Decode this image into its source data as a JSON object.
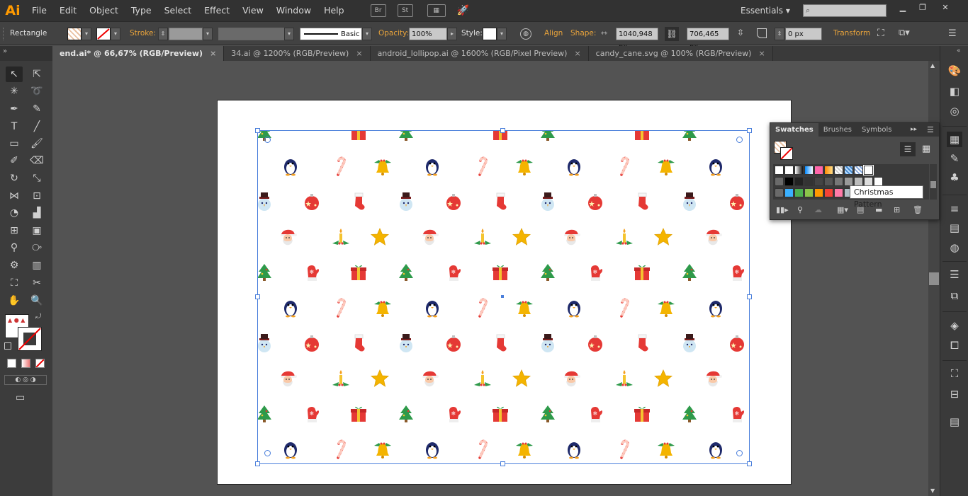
{
  "app": {
    "logo": "Ai",
    "essentials": "Essentials ▾"
  },
  "menu": [
    "File",
    "Edit",
    "Object",
    "Type",
    "Select",
    "Effect",
    "View",
    "Window",
    "Help"
  ],
  "menubar_icons": {
    "bridge": "Br",
    "stock": "St"
  },
  "control": {
    "tool_name": "Rectangle",
    "stroke_label": "Stroke:",
    "brush_label": "Basic",
    "opacity_label": "Opacity:",
    "opacity_value": "100%",
    "style_label": "Style:",
    "align_label": "Align",
    "shape_label": "Shape:",
    "width_value": "1040,948 px",
    "height_value": "706,465 px",
    "corner_value": "0 px",
    "transform_label": "Transform"
  },
  "tabs": [
    {
      "label": "end.ai* @ 66,67% (RGB/Preview)"
    },
    {
      "label": "34.ai @ 1200% (RGB/Preview)"
    },
    {
      "label": "android_lollipop.ai @ 1600% (RGB/Pixel Preview)"
    },
    {
      "label": "candy_cane.svg @ 100% (RGB/Preview)"
    }
  ],
  "tab_close": "×",
  "swatches_panel": {
    "tabs": [
      "Swatches",
      "Brushes",
      "Symbols"
    ],
    "tooltip": "Christmas Pattern"
  },
  "colors": {
    "accent": "#4a7fdb",
    "orange_label": "#e8a33b",
    "ai_logo": "#ff9a00"
  },
  "pattern_rows": [
    [
      "tree",
      "gift",
      "tree",
      "gift",
      "tree",
      "gift",
      "tree"
    ],
    [
      "penguin",
      "cane",
      "bell",
      "penguin",
      "cane",
      "bell",
      "penguin",
      "cane",
      "bell",
      "penguin"
    ],
    [
      "snowman",
      "ornament",
      "stocking",
      "snowman",
      "ornament",
      "stocking",
      "snowman",
      "ornament",
      "stocking",
      "snowman",
      "ornament"
    ],
    [
      "santa",
      "candle",
      "star",
      "santa",
      "candle",
      "star",
      "santa",
      "candle",
      "star",
      "santa"
    ],
    [
      "tree",
      "mitten",
      "gift",
      "tree",
      "mitten",
      "gift",
      "tree",
      "mitten",
      "gift",
      "tree",
      "mitten"
    ],
    [
      "penguin",
      "cane",
      "bell",
      "penguin",
      "cane",
      "bell",
      "penguin",
      "cane",
      "bell",
      "penguin"
    ],
    [
      "snowman",
      "ornament",
      "stocking",
      "snowman",
      "ornament",
      "stocking",
      "snowman",
      "ornament",
      "stocking",
      "snowman",
      "ornament"
    ],
    [
      "santa",
      "candle",
      "star",
      "santa",
      "candle",
      "star",
      "santa",
      "candle",
      "star",
      "santa"
    ],
    [
      "tree",
      "mitten",
      "gift",
      "tree",
      "mitten",
      "gift",
      "tree",
      "mitten",
      "gift",
      "tree",
      "mitten"
    ],
    [
      "penguin",
      "cane",
      "bell",
      "penguin",
      "cane",
      "bell",
      "penguin",
      "cane",
      "bell",
      "penguin"
    ]
  ]
}
